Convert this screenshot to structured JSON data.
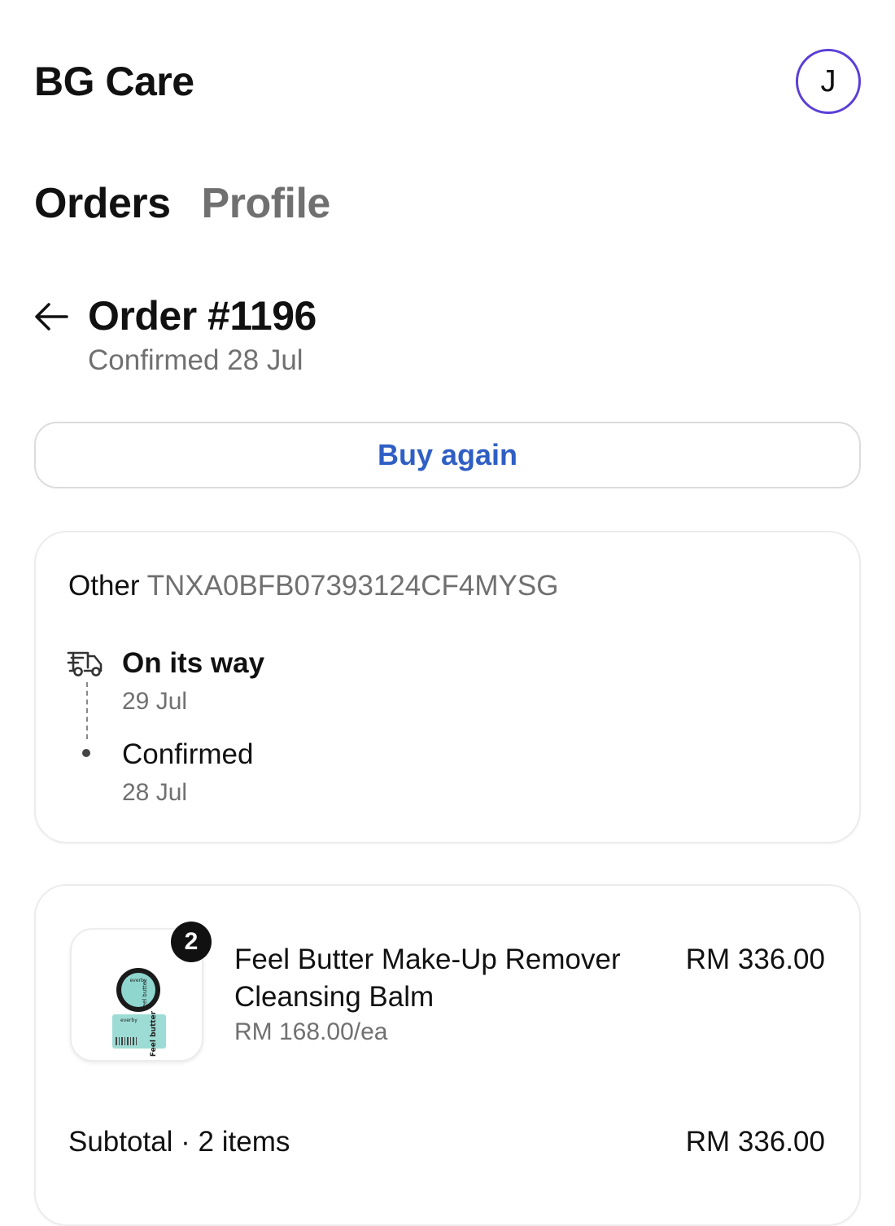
{
  "header": {
    "shop_name": "BG Care",
    "avatar_initial": "J"
  },
  "nav": {
    "tabs": [
      {
        "label": "Orders",
        "active": true
      },
      {
        "label": "Profile",
        "active": false
      }
    ]
  },
  "order": {
    "title": "Order #1196",
    "subtitle": "Confirmed 28 Jul"
  },
  "actions": {
    "buy_again": "Buy again"
  },
  "tracking": {
    "carrier": "Other",
    "tracking_number": "TNXA0BFB07393124CF4MYSG",
    "steps": [
      {
        "title": "On its way",
        "date": "29 Jul"
      },
      {
        "title": "Confirmed",
        "date": "28 Jul"
      }
    ]
  },
  "items": [
    {
      "name": "Feel Butter Make-Up Remover Cleansing Balm",
      "unit_price": "RM 168.00/ea",
      "total": "RM 336.00",
      "quantity": "2",
      "image_text": {
        "brand": "everby",
        "product": "Feel butter"
      }
    }
  ],
  "summary": {
    "subtotal_label": "Subtotal · 2 items",
    "subtotal_value": "RM 336.00"
  },
  "colors": {
    "accent_ring": "#5b3fd6",
    "link": "#2f5fc4",
    "muted": "#707070"
  },
  "icons": {
    "back": "arrow-left-icon",
    "shipping": "truck-icon"
  }
}
